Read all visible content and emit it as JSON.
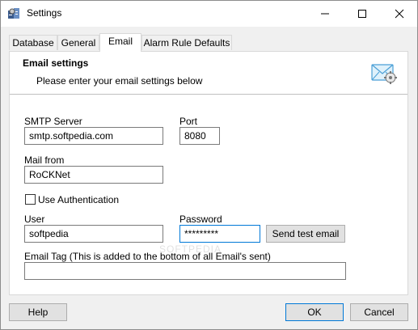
{
  "window": {
    "title": "Settings"
  },
  "tabs": [
    {
      "label": "Database"
    },
    {
      "label": "General"
    },
    {
      "label": "Email"
    },
    {
      "label": "Alarm Rule Defaults"
    }
  ],
  "header": {
    "title": "Email settings",
    "subtitle": "Please enter your email settings below"
  },
  "form": {
    "smtp_label": "SMTP Server",
    "smtp_value": "smtp.softpedia.com",
    "port_label": "Port",
    "port_value": "8080",
    "from_label": "Mail from",
    "from_value": "RoCKNet",
    "auth_label": "Use Authentication",
    "auth_checked": false,
    "user_label": "User",
    "user_value": "softpedia",
    "password_label": "Password",
    "password_value": "*********",
    "test_button": "Send test email",
    "tag_label": "Email Tag (This is added to the bottom of all Email's sent)",
    "tag_value": ""
  },
  "footer": {
    "help": "Help",
    "ok": "OK",
    "cancel": "Cancel"
  },
  "watermark": "SOFTPEDIA",
  "colors": {
    "focus_border": "#0078d7",
    "window_bg": "#f0f0f0"
  }
}
